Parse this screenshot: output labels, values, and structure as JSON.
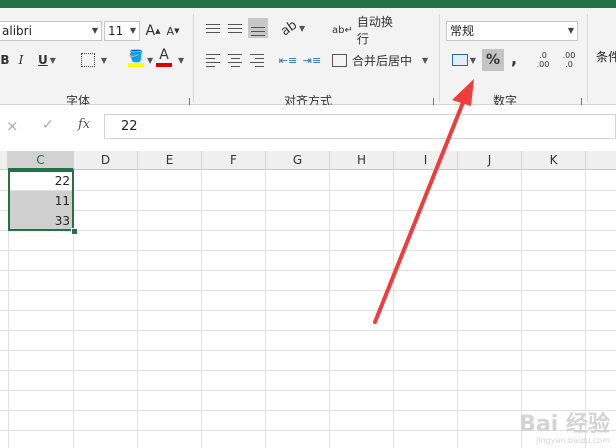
{
  "ribbon": {
    "font": {
      "name": "alibri",
      "size": "11",
      "grow": "A",
      "shrink": "A",
      "bold": "B",
      "italic": "I",
      "underline": "U",
      "color_letter": "A",
      "group_label": "字体",
      "highlight_color": "#ffff00",
      "font_color": "#e00000"
    },
    "alignment": {
      "wrap_text": "自动换行",
      "merge_center": "合并后居中",
      "group_label": "对齐方式"
    },
    "number": {
      "format": "常规",
      "percent": "%",
      "comma": ",",
      "inc_decimal_top": ".0",
      "inc_decimal_bottom": ".00",
      "dec_decimal_top": ".00",
      "dec_decimal_bottom": ".0",
      "group_label": "数字"
    },
    "styles": {
      "conditional_partial": "条件"
    }
  },
  "formula_bar": {
    "cancel": "×",
    "enter": "✓",
    "fx": "fx",
    "value": "22"
  },
  "grid": {
    "columns": [
      "C",
      "D",
      "E",
      "F",
      "G",
      "H",
      "I",
      "J",
      "K"
    ],
    "selected_column": "C",
    "cells": [
      {
        "value": "22"
      },
      {
        "value": "11"
      },
      {
        "value": "33"
      }
    ]
  },
  "annotation": {
    "arrow_color": "#f03c3c"
  },
  "watermark": {
    "brand": "Bai 经验",
    "url": "jingyan.baidu.com"
  },
  "accent": "#217346"
}
